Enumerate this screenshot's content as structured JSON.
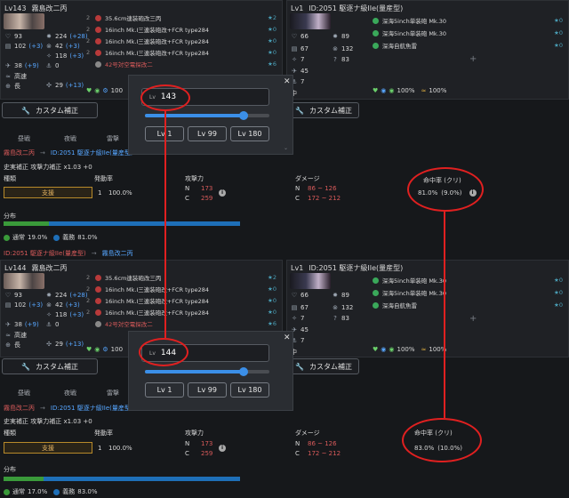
{
  "panels": [
    {
      "left": {
        "level": "Lv143",
        "name": "霧島改二丙",
        "hp": "93",
        "fp": "224",
        "fp_bonus": "(+28)",
        "armor": "102",
        "armor_bonus": "(+3)",
        "torp": "42",
        "torp_bonus": "(+3)",
        "evasion": "118",
        "evasion_bonus": "(+3)",
        "aa": "38",
        "aa_bonus": "(+9)",
        "asw": "0",
        "speed": "高速",
        "range": "長",
        "los": "29",
        "los_bonus": "(+13)",
        "equips": [
          {
            "slot": "2",
            "name": "35.6cm連装砲改三丙",
            "star": "★2"
          },
          {
            "slot": "2",
            "name": "16inch Mk.I三連装砲改+FCR type284",
            "star": "★0"
          },
          {
            "slot": "2",
            "name": "16inch Mk.I三連装砲改+FCR type284",
            "star": "★0"
          },
          {
            "slot": "2",
            "name": "16inch Mk.I三連装砲改+FCR type284",
            "star": "★0"
          },
          {
            "slot": "",
            "name": "42号対空電探改二",
            "star": "★6"
          }
        ],
        "extra": "100"
      },
      "right": {
        "level": "Lv1",
        "id_name": "ID:2051 駆逐ナ級IIe(量産型)",
        "hp": "66",
        "fp": "89",
        "armor": "67",
        "torp": "132",
        "evasion": "7",
        "evasion2": "83",
        "aa": "45",
        "asw": "7",
        "range": "中",
        "equips": [
          {
            "name": "深海5inch単装砲 Mk.30",
            "star": "★0"
          },
          {
            "name": "深海5inch単装砲 Mk.30",
            "star": "★0"
          },
          {
            "name": "深海自航魚雷",
            "star": "★0"
          }
        ],
        "percent": "100%",
        "percent2": "100%"
      },
      "popup": {
        "lv_prefix": "Lv",
        "lv_value": "143",
        "btn1": "Lv 1",
        "btn2": "Lv 99",
        "btn3": "Lv 180",
        "slider": 0.79
      },
      "custom_btn": "カスタム補正",
      "tabs": [
        "昼戦",
        "夜戦",
        "雷撃"
      ],
      "breadcrumb_a": "霧島改二丙",
      "breadcrumb_b": "ID:2051 駆逐ナ級IIe(量産型)",
      "fp_correction": "史実補正 攻撃力補正 x1.03 +0",
      "col_type": "種類",
      "col_rate": "発動率",
      "col_atk": "攻撃力",
      "col_dmg": "ダメージ",
      "col_hit": "命中率 (クリ)",
      "attack_type": "支援",
      "count": "1",
      "rate": "100.0%",
      "atk_n": "173",
      "atk_c": "259",
      "dmg_n": "86 ~ 126",
      "dmg_c": "172 ~ 212",
      "hit": "81.0%",
      "crit": "(9.0%)",
      "dist_label": "分布",
      "normal_label": "通常",
      "normal_pct": "19.0%",
      "crit_label": "義務",
      "crit_pct": "81.0%"
    },
    {
      "left": {
        "level": "Lv144",
        "name": "霧島改二丙",
        "hp": "93",
        "fp": "224",
        "fp_bonus": "(+28)",
        "armor": "102",
        "armor_bonus": "(+3)",
        "torp": "42",
        "torp_bonus": "(+3)",
        "evasion": "118",
        "evasion_bonus": "(+3)",
        "aa": "38",
        "aa_bonus": "(+9)",
        "asw": "0",
        "speed": "高速",
        "range": "長",
        "los": "29",
        "los_bonus": "(+13)",
        "equips": [
          {
            "slot": "2",
            "name": "35.6cm連装砲改三丙",
            "star": "★2"
          },
          {
            "slot": "2",
            "name": "16inch Mk.I三連装砲改+FCR type284",
            "star": "★0"
          },
          {
            "slot": "2",
            "name": "16inch Mk.I三連装砲改+FCR type284",
            "star": "★0"
          },
          {
            "slot": "2",
            "name": "16inch Mk.I三連装砲改+FCR type284",
            "star": "★0"
          },
          {
            "slot": "",
            "name": "42号対空電探改二",
            "star": "★6"
          }
        ],
        "extra": "100"
      },
      "right": {
        "level": "Lv1",
        "id_name": "ID:2051 駆逐ナ級IIe(量産型)",
        "hp": "66",
        "fp": "89",
        "armor": "67",
        "torp": "132",
        "evasion": "7",
        "evasion2": "83",
        "aa": "45",
        "asw": "7",
        "range": "中",
        "equips": [
          {
            "name": "深海5inch単装砲 Mk.30",
            "star": "★0"
          },
          {
            "name": "深海5inch単装砲 Mk.30",
            "star": "★0"
          },
          {
            "name": "深海自航魚雷",
            "star": "★0"
          }
        ],
        "percent": "100%",
        "percent2": "100%"
      },
      "popup": {
        "lv_prefix": "Lv",
        "lv_value": "144",
        "btn1": "Lv 1",
        "btn2": "Lv 99",
        "btn3": "Lv 180",
        "slider": 0.79
      },
      "custom_btn": "カスタム補正",
      "tabs": [
        "昼戦",
        "夜戦",
        "雷撃"
      ],
      "breadcrumb_a": "霧島改二丙",
      "breadcrumb_b": "ID:2051 駆逐ナ級IIe(量産型)",
      "fp_correction": "史実補正 攻撃力補正 x1.03 +0",
      "col_type": "種類",
      "col_rate": "発動率",
      "col_atk": "攻撃力",
      "col_dmg": "ダメージ",
      "col_hit": "命中率 (クリ)",
      "attack_type": "支援",
      "count": "1",
      "rate": "100.0%",
      "atk_n": "173",
      "atk_c": "259",
      "dmg_n": "86 ~ 126",
      "dmg_c": "172 ~ 212",
      "hit": "83.0%",
      "crit": "(10.0%)",
      "dist_label": "分布",
      "normal_label": "通常",
      "normal_pct": "17.0%",
      "crit_label": "義務",
      "crit_pct": "83.0%"
    }
  ],
  "labels": {
    "n": "N",
    "c": "C"
  }
}
